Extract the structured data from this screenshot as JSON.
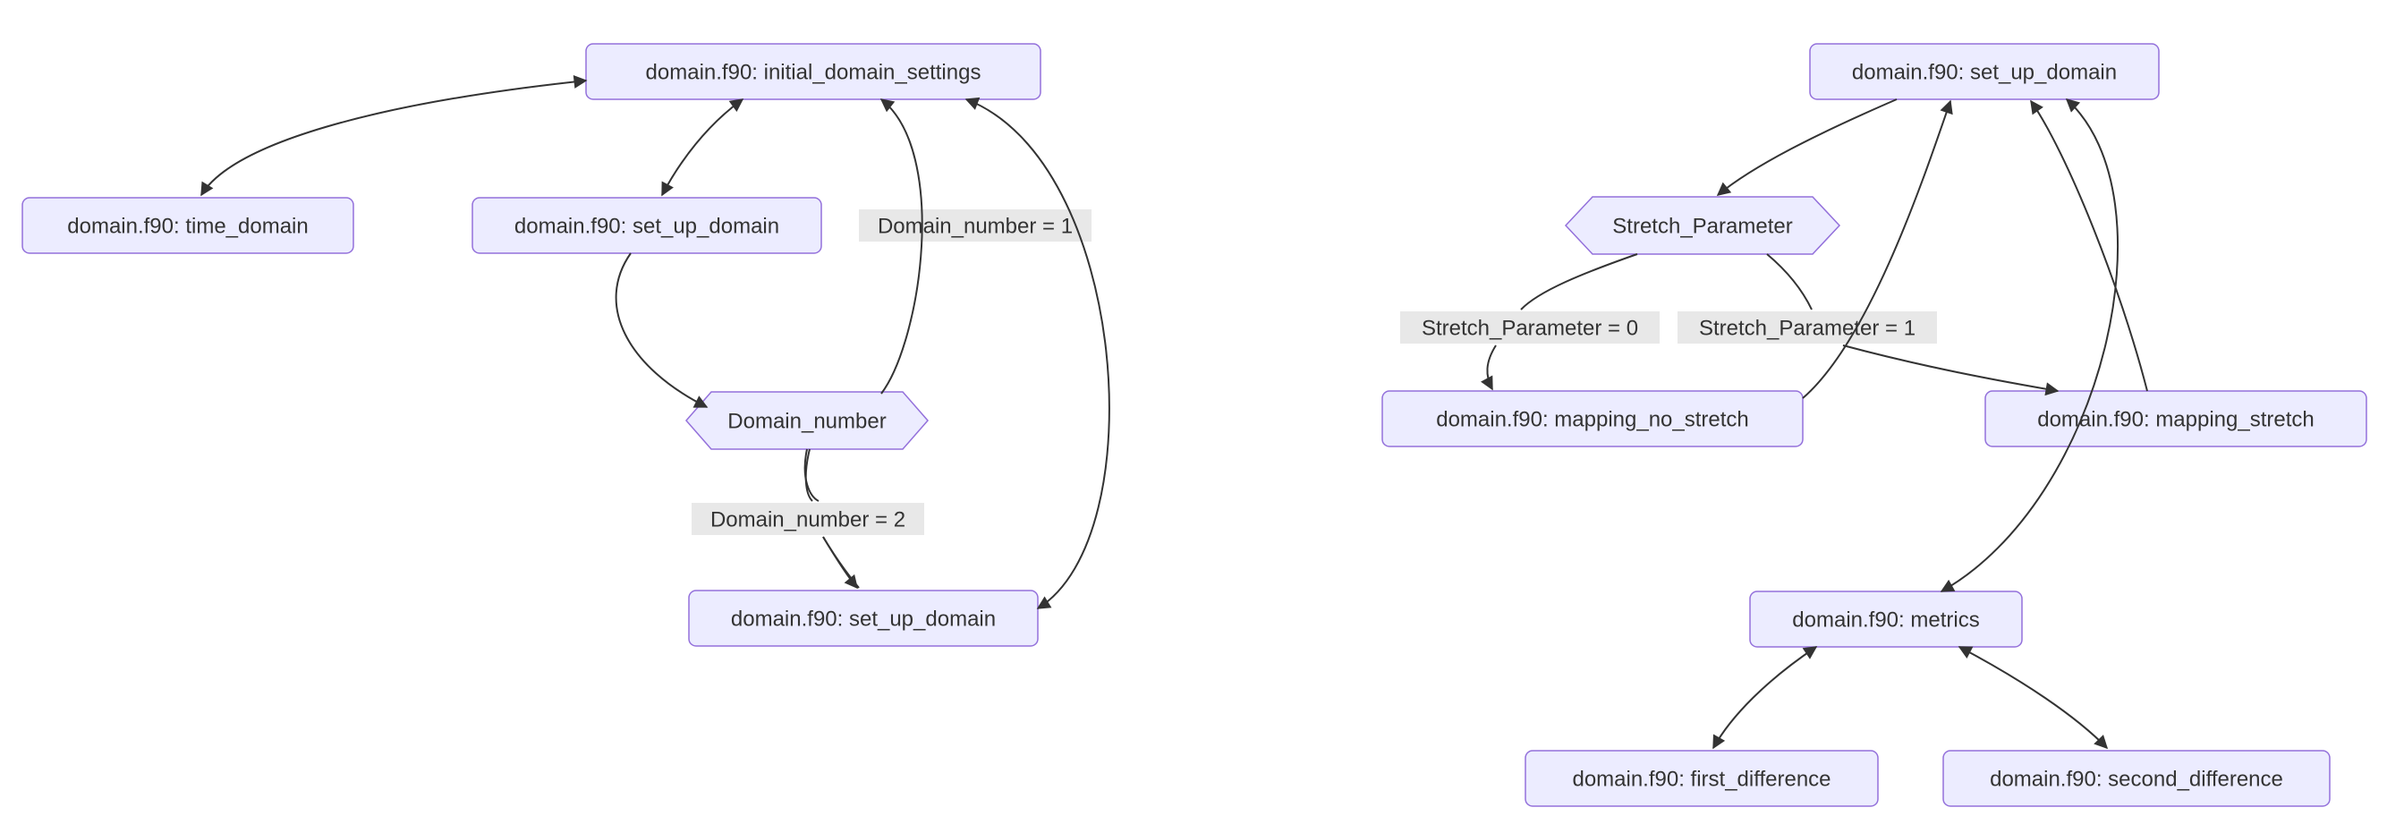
{
  "diagram": {
    "left": {
      "nodes": {
        "initial": "domain.f90: initial_domain_settings",
        "time": "domain.f90: time_domain",
        "setup1": "domain.f90: set_up_domain",
        "decision": "Domain_number",
        "setup2": "domain.f90: set_up_domain"
      },
      "edge_labels": {
        "d1": "Domain_number = 1",
        "d2": "Domain_number = 2"
      }
    },
    "right": {
      "nodes": {
        "setup": "domain.f90: set_up_domain",
        "decision": "Stretch_Parameter",
        "no_stretch": "domain.f90: mapping_no_stretch",
        "stretch": "domain.f90: mapping_stretch",
        "metrics": "domain.f90: metrics",
        "first": "domain.f90: first_difference",
        "second": "domain.f90: second_difference"
      },
      "edge_labels": {
        "p0": "Stretch_Parameter = 0",
        "p1": "Stretch_Parameter = 1"
      }
    }
  }
}
